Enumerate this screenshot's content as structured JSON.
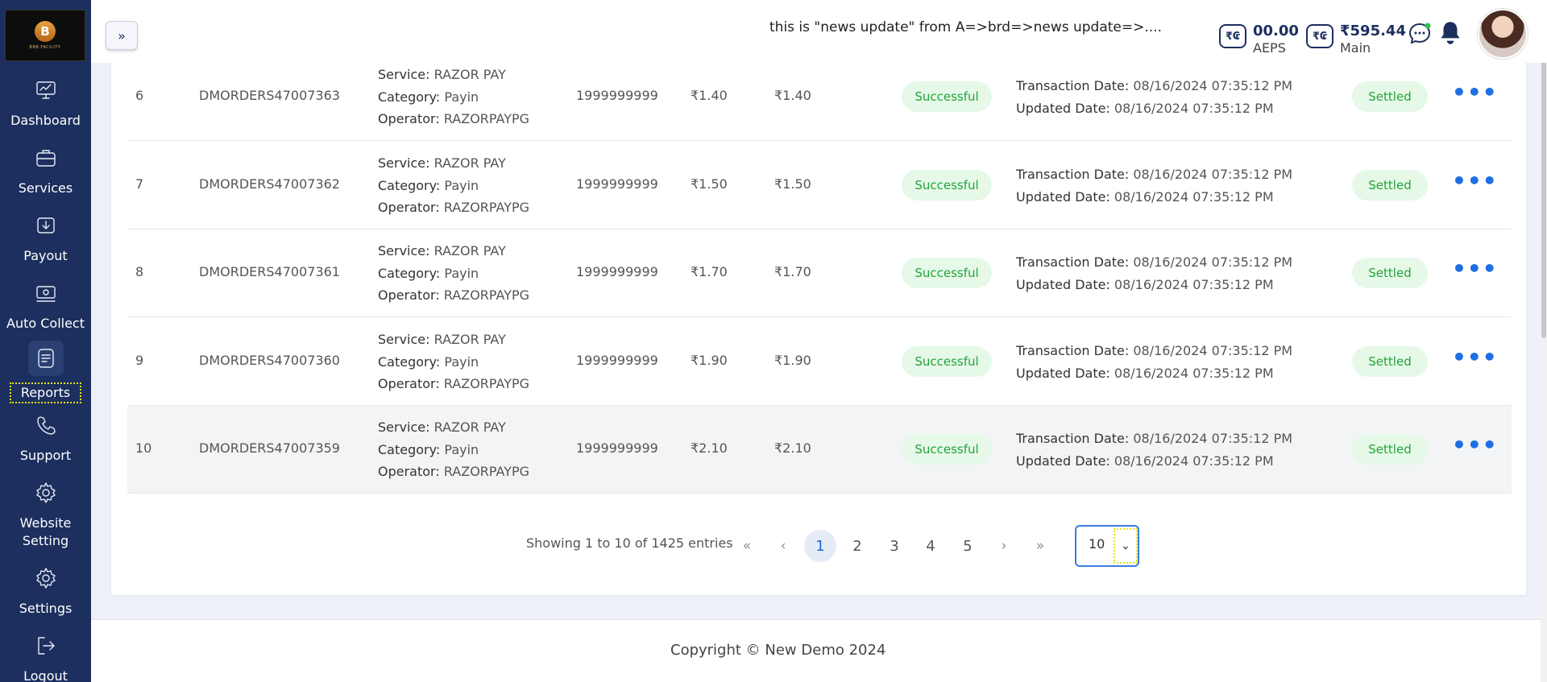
{
  "news_ticker": "this is \"news update\" from A=>brd=>news update=>....",
  "wallets": [
    {
      "amount": "00.00",
      "label": "AEPS",
      "icon": "rupee-wallet-icon"
    },
    {
      "amount": "₹595.44",
      "label": "Main",
      "icon": "rupee-wallet-icon"
    }
  ],
  "logo_text": "B",
  "logo_sub": "BBB FACILITY",
  "sidebar": {
    "items": [
      {
        "label": "Dashboard",
        "icon": "dashboard-icon"
      },
      {
        "label": "Services",
        "icon": "briefcase-icon"
      },
      {
        "label": "Payout",
        "icon": "payout-icon"
      },
      {
        "label": "Auto Collect",
        "icon": "auto-collect-icon"
      },
      {
        "label": "Reports",
        "icon": "reports-icon",
        "active": true
      },
      {
        "label": "Support",
        "icon": "phone-icon"
      },
      {
        "label": "Website Setting",
        "icon": "gear-icon"
      },
      {
        "label": "Settings",
        "icon": "gear-icon"
      },
      {
        "label": "Logout",
        "icon": "logout-icon"
      }
    ]
  },
  "table": {
    "rows": [
      {
        "no": "6",
        "order_id": "DMORDERS47007363",
        "service_label": "Service:",
        "service": "RAZOR PAY",
        "category_label": "Category:",
        "category": "Payin",
        "operator_label": "Operator:",
        "operator": "RAZORPAYPG",
        "mobile": "1999999999",
        "amount": "₹1.40",
        "net": "₹1.40",
        "status": "Successful",
        "txn_label": "Transaction Date:",
        "txn_date": "08/16/2024 07:35:12 PM",
        "upd_label": "Updated Date:",
        "upd_date": "08/16/2024 07:35:12 PM",
        "settlement": "Settled"
      },
      {
        "no": "7",
        "order_id": "DMORDERS47007362",
        "service_label": "Service:",
        "service": "RAZOR PAY",
        "category_label": "Category:",
        "category": "Payin",
        "operator_label": "Operator:",
        "operator": "RAZORPAYPG",
        "mobile": "1999999999",
        "amount": "₹1.50",
        "net": "₹1.50",
        "status": "Successful",
        "txn_label": "Transaction Date:",
        "txn_date": "08/16/2024 07:35:12 PM",
        "upd_label": "Updated Date:",
        "upd_date": "08/16/2024 07:35:12 PM",
        "settlement": "Settled"
      },
      {
        "no": "8",
        "order_id": "DMORDERS47007361",
        "service_label": "Service:",
        "service": "RAZOR PAY",
        "category_label": "Category:",
        "category": "Payin",
        "operator_label": "Operator:",
        "operator": "RAZORPAYPG",
        "mobile": "1999999999",
        "amount": "₹1.70",
        "net": "₹1.70",
        "status": "Successful",
        "txn_label": "Transaction Date:",
        "txn_date": "08/16/2024 07:35:12 PM",
        "upd_label": "Updated Date:",
        "upd_date": "08/16/2024 07:35:12 PM",
        "settlement": "Settled"
      },
      {
        "no": "9",
        "order_id": "DMORDERS47007360",
        "service_label": "Service:",
        "service": "RAZOR PAY",
        "category_label": "Category:",
        "category": "Payin",
        "operator_label": "Operator:",
        "operator": "RAZORPAYPG",
        "mobile": "1999999999",
        "amount": "₹1.90",
        "net": "₹1.90",
        "status": "Successful",
        "txn_label": "Transaction Date:",
        "txn_date": "08/16/2024 07:35:12 PM",
        "upd_label": "Updated Date:",
        "upd_date": "08/16/2024 07:35:12 PM",
        "settlement": "Settled"
      },
      {
        "no": "10",
        "order_id": "DMORDERS47007359",
        "service_label": "Service:",
        "service": "RAZOR PAY",
        "category_label": "Category:",
        "category": "Payin",
        "operator_label": "Operator:",
        "operator": "RAZORPAYPG",
        "mobile": "1999999999",
        "amount": "₹2.10",
        "net": "₹2.10",
        "status": "Successful",
        "txn_label": "Transaction Date:",
        "txn_date": "08/16/2024 07:35:12 PM",
        "upd_label": "Updated Date:",
        "upd_date": "08/16/2024 07:35:12 PM",
        "settlement": "Settled"
      }
    ]
  },
  "pagination": {
    "showing": "Showing 1 to 10 of 1425 entries",
    "first": "«",
    "prev": "‹",
    "pages": [
      "1",
      "2",
      "3",
      "4",
      "5"
    ],
    "current": "1",
    "next": "›",
    "last": "»",
    "page_size": "10"
  },
  "footer": {
    "copyright": "Copyright © New Demo 2024"
  },
  "colors": {
    "sidebar": "#1c2f5e",
    "accent": "#1d6fe3",
    "success_bg": "#e6f8e8",
    "success_text": "#22a43a"
  }
}
